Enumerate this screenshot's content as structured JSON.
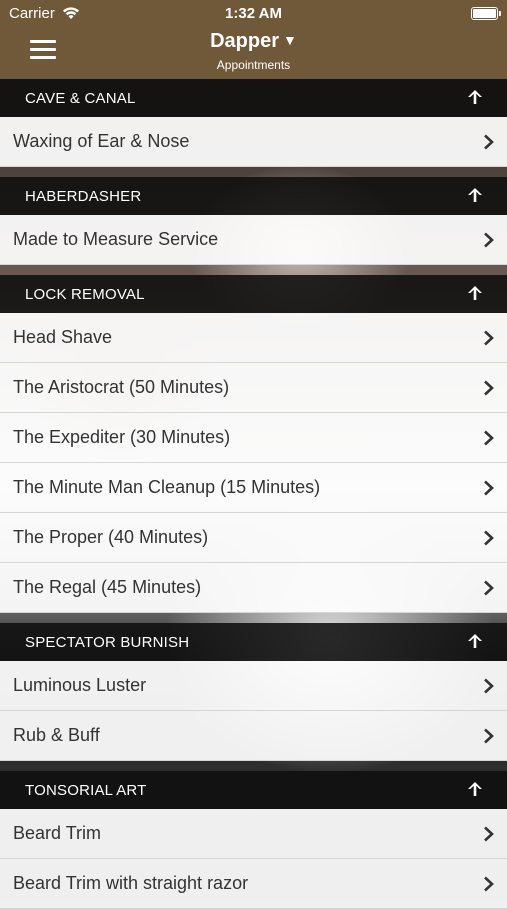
{
  "status_bar": {
    "carrier": "Carrier",
    "time": "1:32 AM"
  },
  "navbar": {
    "title": "Dapper",
    "title_caret": "▼",
    "subtitle": "Appointments"
  },
  "sections": [
    {
      "header": "CAVE & CANAL",
      "items": [
        "Waxing of Ear & Nose"
      ]
    },
    {
      "header": "HABERDASHER",
      "items": [
        "Made to Measure Service"
      ]
    },
    {
      "header": "LOCK REMOVAL",
      "items": [
        "Head Shave",
        "The Aristocrat (50 Minutes)",
        "The Expediter (30 Minutes)",
        "The Minute Man Cleanup (15 Minutes)",
        "The Proper (40 Minutes)",
        "The Regal (45 Minutes)"
      ]
    },
    {
      "header": "SPECTATOR BURNISH",
      "items": [
        "Luminous Luster",
        "Rub & Buff"
      ]
    },
    {
      "header": "TONSORIAL ART",
      "items": [
        "Beard Trim",
        "Beard Trim with straight razor"
      ]
    }
  ],
  "colors": {
    "navbar": "#6f5939",
    "section_header": "#0f0f0f",
    "row_text": "#333333"
  }
}
